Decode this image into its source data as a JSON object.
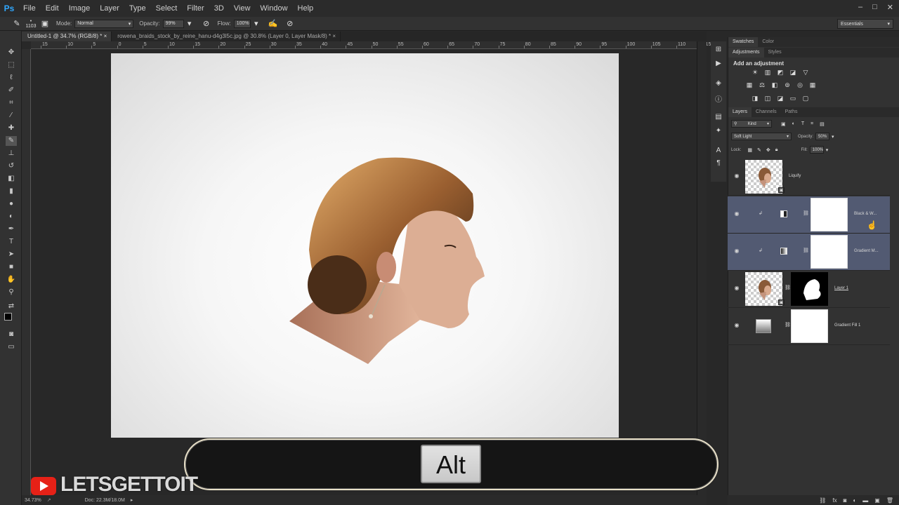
{
  "app": {
    "logo": "Ps",
    "window_controls": [
      "–",
      "□",
      "✕"
    ]
  },
  "menu": [
    "File",
    "Edit",
    "Image",
    "Layer",
    "Type",
    "Select",
    "Filter",
    "3D",
    "View",
    "Window",
    "Help"
  ],
  "options": {
    "brush_size": "1103",
    "mode_label": "Mode:",
    "mode_value": "Normal",
    "opacity_label": "Opacity:",
    "opacity_value": "99%",
    "flow_label": "Flow:",
    "flow_value": "100%",
    "workspace": "Essentials"
  },
  "tabs": [
    {
      "label": "Untitled-1 @ 34.7% (RGB/8) *",
      "active": true
    },
    {
      "label": "rowena_braids_stock_by_reine_hanu-d4g3l5c.jpg @ 30.8% (Layer 0, Layer Mask/8) *",
      "active": false
    }
  ],
  "ruler_top": [
    "15",
    "10",
    "5",
    "0",
    "5",
    "10",
    "15",
    "20",
    "25",
    "30",
    "35",
    "40",
    "45",
    "50",
    "55",
    "60",
    "65",
    "70",
    "75",
    "80",
    "85",
    "90",
    "95",
    "100",
    "105",
    "110",
    "115"
  ],
  "status": {
    "zoom": "34.73%",
    "doc": "Doc: 22.3M/18.0M"
  },
  "panels": {
    "top_tabs": [
      "Swatches",
      "Color"
    ],
    "adj_tabs": [
      "Adjustments",
      "Styles"
    ],
    "adj_title": "Add an adjustment",
    "layer_tabs": [
      "Layers",
      "Channels",
      "Paths"
    ],
    "filter_kind": "Kind",
    "blend_mode": "Soft Light",
    "opacity_label": "Opacity:",
    "opacity_value": "50%",
    "lock_label": "Lock:",
    "fill_label": "Fill:",
    "fill_value": "100%"
  },
  "layers": [
    {
      "name": "Liquify",
      "selected": false
    },
    {
      "name": "Black & W...",
      "selected": true
    },
    {
      "name": "Gradient M...",
      "selected": true
    },
    {
      "name": "Layer 1",
      "selected": false
    },
    {
      "name": "Gradient Fill 1",
      "selected": false
    }
  ],
  "overlay": {
    "key": "Alt"
  },
  "watermark": {
    "brand": "LETSGETTOIT"
  },
  "colors": {
    "accent": "#31a8ff",
    "selection": "#525a72",
    "youtube": "#e62117"
  }
}
